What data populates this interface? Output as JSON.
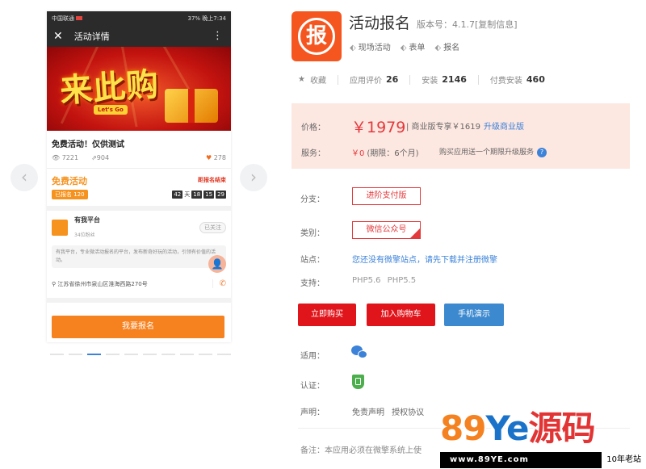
{
  "preview": {
    "status_left": "中国联通",
    "status_right": "37% 晚上7:34",
    "nav_title": "活动详情",
    "banner_big": "来此购",
    "banner_sub": "Let's Go",
    "activity_title": "免费活动！仅供测试",
    "views": "7221",
    "shares": "904",
    "likes": "278",
    "free_label": "免费活动",
    "deadline_label": "距报名结束",
    "signed_badge": "已报名 120",
    "countdown": {
      "days": "42",
      "day_unit": "天",
      "h": "18",
      "m": "15",
      "s": "29"
    },
    "org_name": "有我平台",
    "org_sub": "34位粉丝",
    "follow_label": "已关注",
    "org_desc": "有我平台，专业微活动报名的平台，发布新奇好玩的活动，引领有价值的活动。",
    "address": "江苏省徐州市泉山区淮海西路270号",
    "signup_button": "我要报名",
    "slides": 10,
    "active_slide": 2
  },
  "app": {
    "name": "活动报名",
    "version": "版本号：4.1.7[复制信息]",
    "tags": [
      "现场活动",
      "表单",
      "报名"
    ],
    "stats": {
      "favorite_label": "收藏",
      "rating_label": "应用评价",
      "rating_value": "26",
      "install_label": "安装",
      "install_value": "2146",
      "paid_label": "付费安装",
      "paid_value": "460"
    }
  },
  "pricing": {
    "price_label": "价格：",
    "price": "￥1979",
    "business_price": "| 商业版专享￥1619",
    "upgrade_link": "升级商业版",
    "service_label": "服务：",
    "service_value": "￥0",
    "service_period": "(期限：6个月)",
    "service_note": "购买应用送一个期限升级服务"
  },
  "options": {
    "branch_label": "分支：",
    "branch_value": "进阶支付版",
    "type_label": "类别：",
    "type_value": "微信公众号",
    "site_label": "站点：",
    "site_link": "您还没有微擎站点，请先下载并注册微擎",
    "support_label": "支持：",
    "support_value": "PHP5.6 PHP5.5"
  },
  "actions": {
    "buy": "立即购买",
    "cart": "加入购物车",
    "demo": "手机演示"
  },
  "meta": {
    "apply_label": "适用：",
    "cert_label": "认证：",
    "decl_label": "声明：",
    "decl_value": "免责声明 授权协议",
    "note": "备注：本应用必须在微擎系统上使"
  },
  "watermark": {
    "brand_a": "89",
    "brand_b": "Ye",
    "brand_c": "源码",
    "url": "www.89YE.com",
    "years": "10年老站"
  },
  "colors": {
    "accent_red": "#e4393c",
    "link_blue": "#3b82d8",
    "orange": "#f6811f"
  }
}
